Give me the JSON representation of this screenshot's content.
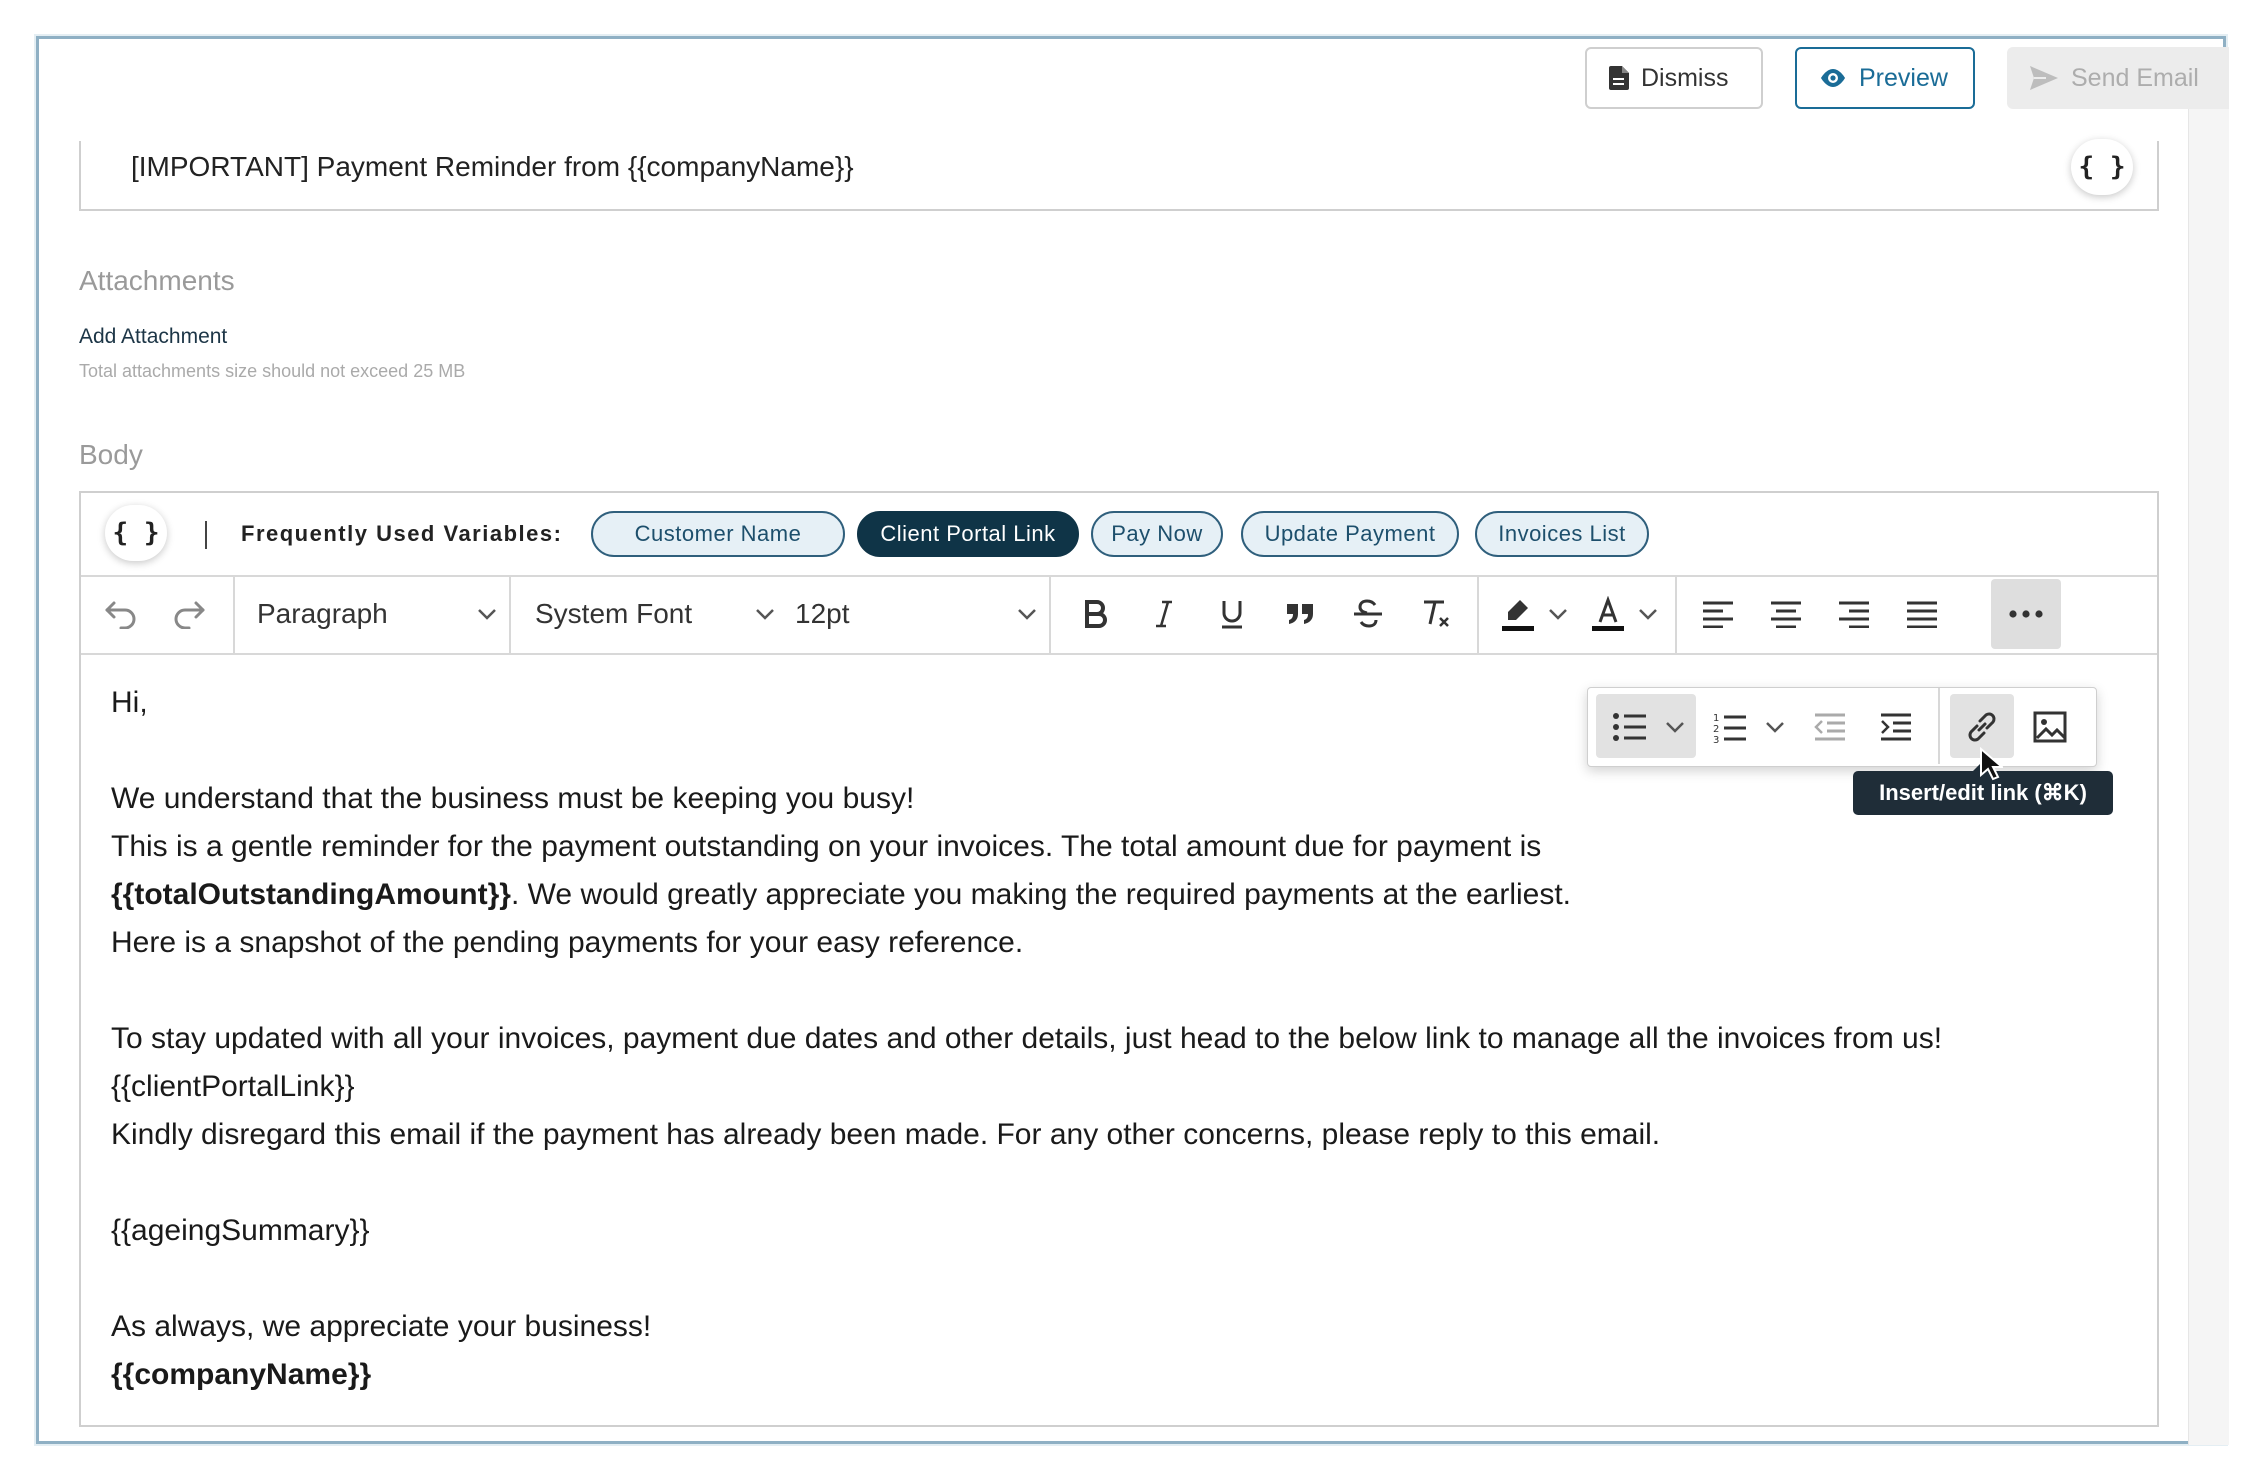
{
  "actions": {
    "dismiss_label": "Dismiss",
    "preview_label": "Preview",
    "send_label": "Send Email"
  },
  "subject": {
    "value": "[IMPORTANT] Payment Reminder from {{companyName}}",
    "variable_button": "{ }"
  },
  "attachments": {
    "heading": "Attachments",
    "add_link": "Add Attachment",
    "hint": "Total attachments size should not exceed 25 MB"
  },
  "body": {
    "heading": "Body",
    "variable_button": "{ }",
    "frequent_vars_title": "Frequently Used Variables:",
    "chips": [
      {
        "label": "Customer Name",
        "active": false
      },
      {
        "label": "Client Portal Link",
        "active": true
      },
      {
        "label": "Pay Now",
        "active": false
      },
      {
        "label": "Update Payment",
        "active": false
      },
      {
        "label": "Invoices List",
        "active": false
      }
    ],
    "toolbar": {
      "block_format": "Paragraph",
      "font_family": "System Font",
      "font_size": "12pt"
    },
    "tooltip": "Insert/edit link (⌘K)",
    "lines": [
      "Hi,",
      "",
      "We understand that the business must be keeping you busy!",
      "This is a gentle reminder for the payment outstanding on your invoices. The total amount due for payment is",
      "{{totalOutstandingAmount}}",
      ". We would greatly appreciate you making the required payments at the earliest.",
      "Here is a snapshot of the pending payments for your easy reference.",
      "",
      "To stay updated with all your invoices, payment due dates and other details, just head to the below link to manage all the invoices from us!",
      "{{clientPortalLink}}",
      "Kindly disregard this email if the payment has already been made. For any other concerns, please reply to this email.",
      "",
      "{{ageingSummary}}",
      "",
      "As always, we appreciate your business!",
      "{{companyName}}"
    ]
  },
  "colors": {
    "accent": "#1a6c97",
    "chip_active": "#0f3447",
    "chip_border": "#2f5f7c",
    "tooltip_bg": "#1f2d38"
  },
  "icons": [
    "document-icon",
    "eye-icon",
    "send-icon",
    "undo-icon",
    "redo-icon",
    "chevron-down-icon",
    "bold-icon",
    "italic-icon",
    "underline-icon",
    "blockquote-icon",
    "strikethrough-icon",
    "clear-format-icon",
    "highlight-icon",
    "text-color-icon",
    "align-left-icon",
    "align-center-icon",
    "align-right-icon",
    "align-justify-icon",
    "more-icon",
    "bullet-list-icon",
    "numbered-list-icon",
    "outdent-icon",
    "indent-icon",
    "link-icon",
    "image-icon",
    "cursor-icon"
  ]
}
